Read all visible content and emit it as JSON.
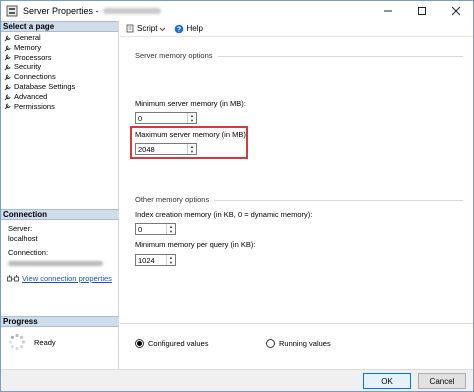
{
  "window": {
    "title": "Server Properties -"
  },
  "left": {
    "select_page_header": "Select a page",
    "pages": [
      {
        "label": "General"
      },
      {
        "label": "Memory"
      },
      {
        "label": "Processors"
      },
      {
        "label": "Security"
      },
      {
        "label": "Connections"
      },
      {
        "label": "Database Settings"
      },
      {
        "label": "Advanced"
      },
      {
        "label": "Permissions"
      }
    ],
    "connection_header": "Connection",
    "server_label": "Server:",
    "server_value": "localhost",
    "connection_label": "Connection:",
    "view_props_link": "View connection properties",
    "progress_header": "Progress",
    "progress_status": "Ready"
  },
  "toolbar": {
    "script_label": "Script",
    "help_label": "Help"
  },
  "memory": {
    "server_memory_title": "Server memory options",
    "min_label": "Minimum server memory (in MB):",
    "min_value": "0",
    "max_label": "Maximum server memory (in MB):",
    "max_value": "2048",
    "other_title": "Other memory options",
    "index_label": "Index creation memory (in KB, 0 = dynamic memory):",
    "index_value": "0",
    "min_query_label": "Minimum memory per query (in KB):",
    "min_query_value": "1024"
  },
  "options": {
    "configured_label": "Configured values",
    "running_label": "Running values",
    "selected": "configured"
  },
  "footer": {
    "ok_label": "OK",
    "cancel_label": "Cancel"
  },
  "colors": {
    "highlight": "#d9383a",
    "header_bg": "#cfdcea",
    "link": "#1a56b0"
  }
}
